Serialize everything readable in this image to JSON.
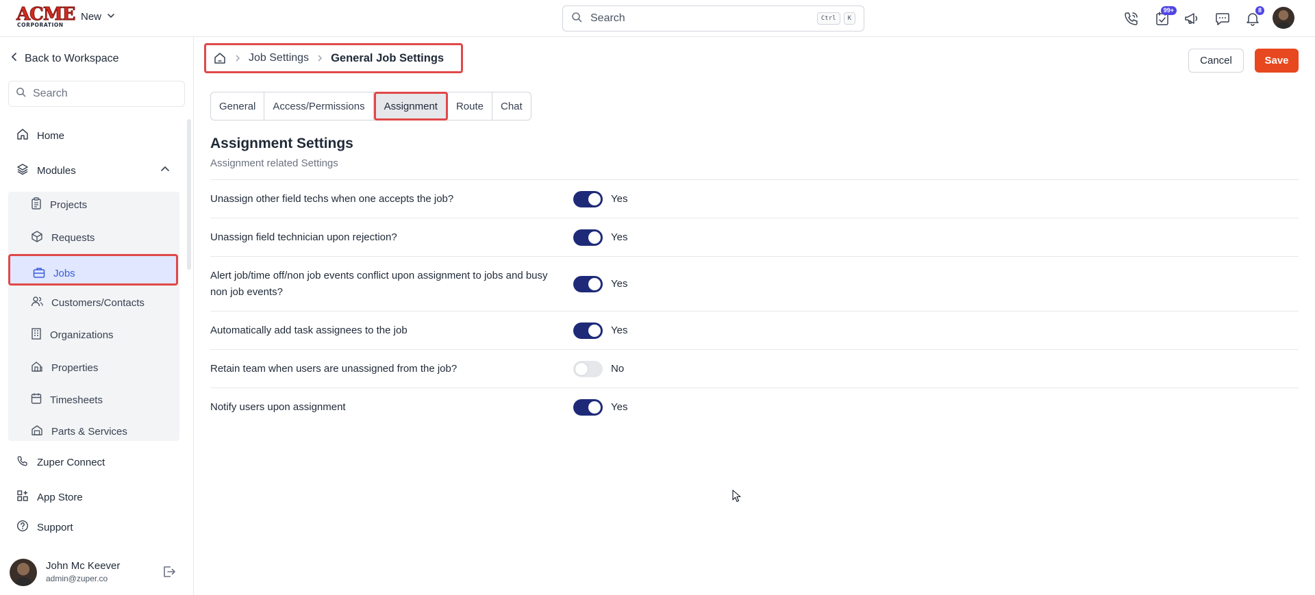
{
  "header": {
    "logo_main": "ACME",
    "logo_sub": "CORPORATION",
    "new_label": "New",
    "search_placeholder": "Search",
    "shortcut_ctrl": "Ctrl",
    "shortcut_k": "K",
    "tasks_badge": "99+",
    "notifications_badge": "8",
    "icons": [
      "phone-icon",
      "tasks-icon",
      "megaphone-icon",
      "chat-icon",
      "bell-icon"
    ]
  },
  "sidebar": {
    "back_label": "Back to Workspace",
    "search_placeholder": "Search",
    "home_label": "Home",
    "modules_label": "Modules",
    "modules": [
      {
        "label": "Projects",
        "icon": "clipboard-icon"
      },
      {
        "label": "Requests",
        "icon": "request-box-icon"
      },
      {
        "label": "Jobs",
        "icon": "briefcase-icon"
      },
      {
        "label": "Customers/Contacts",
        "icon": "users-icon"
      },
      {
        "label": "Organizations",
        "icon": "building-icon"
      },
      {
        "label": "Properties",
        "icon": "property-icon"
      },
      {
        "label": "Timesheets",
        "icon": "calendar-icon"
      },
      {
        "label": "Parts & Services",
        "icon": "parts-icon"
      }
    ],
    "active_module": "Jobs",
    "zuper_connect_label": "Zuper Connect",
    "app_store_label": "App Store",
    "support_label": "Support",
    "user": {
      "name": "John Mc Keever",
      "email": "admin@zuper.co"
    }
  },
  "breadcrumb": {
    "items": [
      "Job Settings",
      "General Job Settings"
    ]
  },
  "actions": {
    "cancel_label": "Cancel",
    "save_label": "Save"
  },
  "tabs": [
    {
      "label": "General"
    },
    {
      "label": "Access/Permissions"
    },
    {
      "label": "Assignment",
      "active": true
    },
    {
      "label": "Route"
    },
    {
      "label": "Chat"
    }
  ],
  "section": {
    "title": "Assignment Settings",
    "subtitle": "Assignment related Settings"
  },
  "settings": [
    {
      "question": "Unassign other field techs when one accepts the job?",
      "enabled": true,
      "value": "Yes"
    },
    {
      "question": "Unassign field technician upon rejection?",
      "enabled": true,
      "value": "Yes"
    },
    {
      "question": "Alert job/time off/non job events conflict upon assignment to jobs and busy non job events?",
      "enabled": true,
      "value": "Yes"
    },
    {
      "question": "Automatically add task assignees to the job",
      "enabled": true,
      "value": "Yes"
    },
    {
      "question": "Retain team when users are unassigned from the job?",
      "enabled": false,
      "value": "No"
    },
    {
      "question": "Notify users upon assignment",
      "enabled": true,
      "value": "Yes"
    }
  ],
  "colors": {
    "accent": "#e8481f",
    "toggle_on": "#1e2a78",
    "active_nav": "#3b5bdb",
    "highlight_border": "#e04848",
    "badge": "#4f46e5"
  }
}
